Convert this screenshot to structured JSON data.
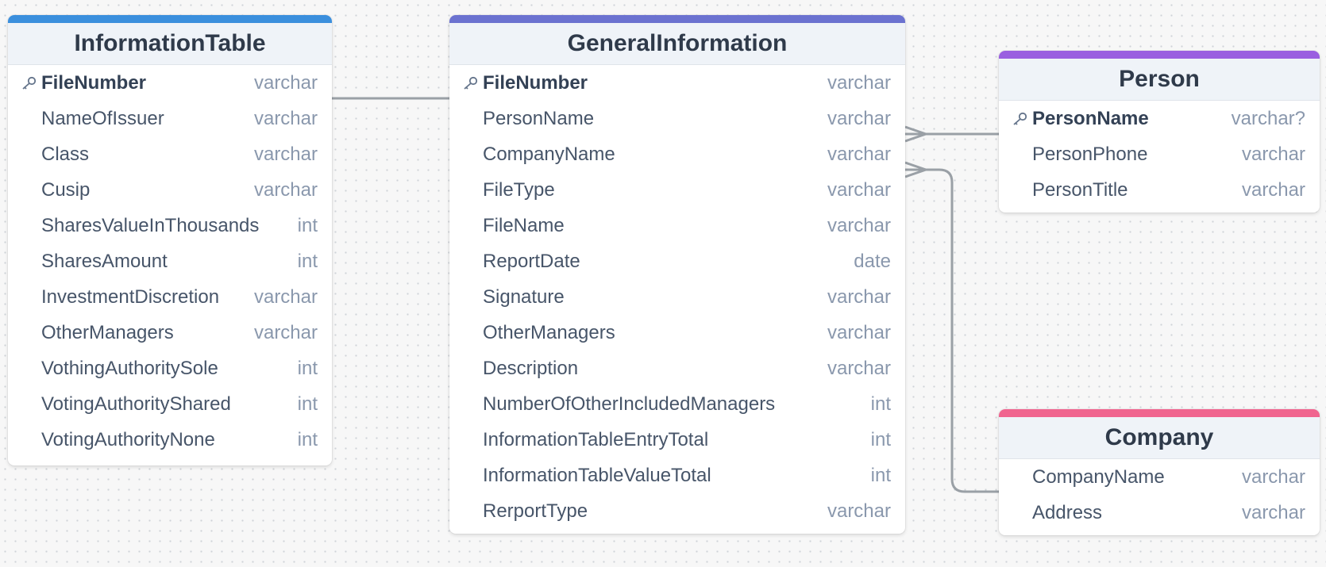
{
  "tables": {
    "information_table": {
      "name": "InformationTable",
      "accent": "#3b8fdd",
      "fields": [
        {
          "name": "FileNumber",
          "type": "varchar",
          "pk": true
        },
        {
          "name": "NameOfIssuer",
          "type": "varchar"
        },
        {
          "name": "Class",
          "type": "varchar"
        },
        {
          "name": "Cusip",
          "type": "varchar"
        },
        {
          "name": "SharesValueInThousands",
          "type": "int"
        },
        {
          "name": "SharesAmount",
          "type": "int"
        },
        {
          "name": "InvestmentDiscretion",
          "type": "varchar"
        },
        {
          "name": "OtherManagers",
          "type": "varchar"
        },
        {
          "name": "VothingAuthoritySole",
          "type": "int"
        },
        {
          "name": "VotingAuthorityShared",
          "type": "int"
        },
        {
          "name": "VotingAuthorityNone",
          "type": "int"
        }
      ]
    },
    "general_information": {
      "name": "GeneralInformation",
      "accent": "#6b72d0",
      "fields": [
        {
          "name": "FileNumber",
          "type": "varchar",
          "pk": true
        },
        {
          "name": "PersonName",
          "type": "varchar"
        },
        {
          "name": "CompanyName",
          "type": "varchar"
        },
        {
          "name": "FileType",
          "type": "varchar"
        },
        {
          "name": "FileName",
          "type": "varchar"
        },
        {
          "name": "ReportDate",
          "type": "date"
        },
        {
          "name": "Signature",
          "type": "varchar"
        },
        {
          "name": "OtherManagers",
          "type": "varchar"
        },
        {
          "name": "Description",
          "type": "varchar"
        },
        {
          "name": "NumberOfOtherIncludedManagers",
          "type": "int"
        },
        {
          "name": "InformationTableEntryTotal",
          "type": "int"
        },
        {
          "name": "InformationTableValueTotal",
          "type": "int"
        },
        {
          "name": "RerportType",
          "type": "varchar"
        }
      ]
    },
    "person": {
      "name": "Person",
      "accent": "#9a5fe0",
      "fields": [
        {
          "name": "PersonName",
          "type": "varchar?",
          "pk": true
        },
        {
          "name": "PersonPhone",
          "type": "varchar"
        },
        {
          "name": "PersonTitle",
          "type": "varchar"
        }
      ]
    },
    "company": {
      "name": "Company",
      "accent": "#f0648f",
      "fields": [
        {
          "name": "CompanyName",
          "type": "varchar"
        },
        {
          "name": "Address",
          "type": "varchar"
        }
      ]
    }
  },
  "relationships": [
    {
      "from": "InformationTable.FileNumber",
      "to": "GeneralInformation.FileNumber",
      "cardinality": "one-to-one"
    },
    {
      "from": "GeneralInformation.PersonName",
      "to": "Person.PersonName",
      "cardinality": "many-to-one"
    },
    {
      "from": "GeneralInformation.CompanyName",
      "to": "Company.CompanyName",
      "cardinality": "many-to-one"
    }
  ],
  "colors": {
    "connector": "#9aa0a6",
    "header_bg": "#eff3f8",
    "type_text": "#8a98ad"
  }
}
